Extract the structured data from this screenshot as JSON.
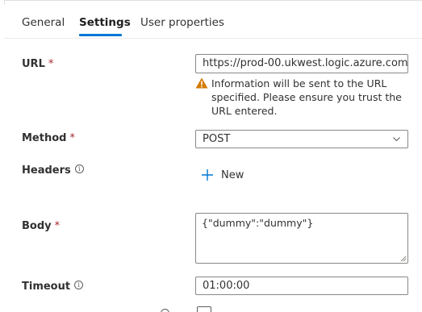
{
  "tabs": [
    {
      "label": "General"
    },
    {
      "label": "Settings"
    },
    {
      "label": "User properties"
    }
  ],
  "active_tab": "Settings",
  "accent_color": "#0078d4",
  "required_marker": "*",
  "form": {
    "url": {
      "label": "URL",
      "value": "https://prod-00.ukwest.logic.azure.com:4...",
      "warning_text": "Information will be sent to the URL specified. Please ensure you trust the URL entered.",
      "warning_icon": "warning-triangle-icon"
    },
    "method": {
      "label": "Method",
      "value": "POST",
      "icon": "chevron-down-icon"
    },
    "headers": {
      "label": "Headers",
      "info_icon": "info-icon",
      "add_label": "New",
      "add_icon": "plus-icon"
    },
    "body": {
      "label": "Body",
      "value": "{\"dummy\":\"dummy\"}"
    },
    "timeout": {
      "label": "Timeout",
      "info_icon": "info-icon",
      "value": "01:00:00"
    }
  }
}
